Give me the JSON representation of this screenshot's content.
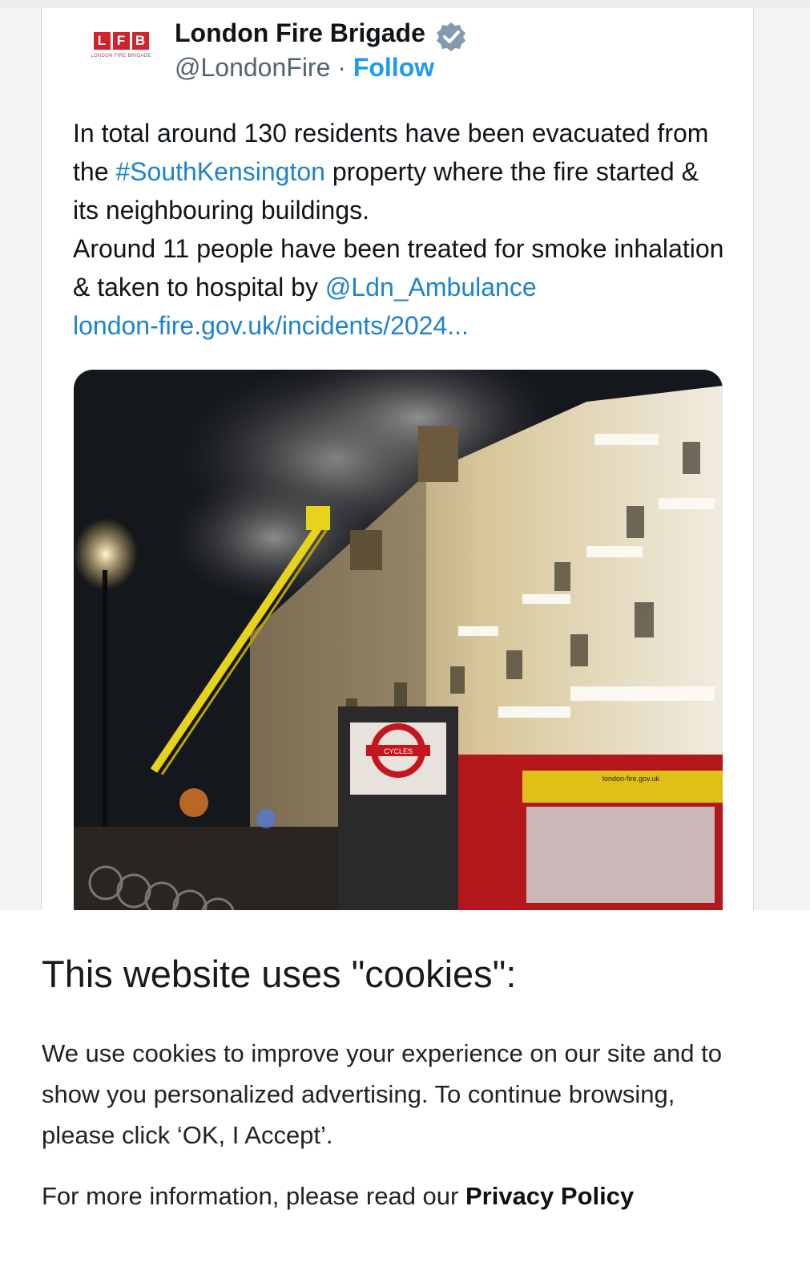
{
  "tweet": {
    "author_name": "London Fire Brigade",
    "handle": "@LondonFire",
    "separator": "·",
    "follow_label": "Follow",
    "logo": {
      "letters": [
        "L",
        "F",
        "B"
      ],
      "subtitle": "LONDON FIRE BRIGADE"
    },
    "text": {
      "line1_pre": "In total around 130 residents have been evacuated from the ",
      "hashtag": "#SouthKensington",
      "line1_post": " property where the fire started & its neighbouring buildings.",
      "line2_pre": "Around 11 people have been treated for smoke inhalation & taken to hospital by ",
      "mention": "@Ldn_Ambulance",
      "link": "london-fire.gov.uk/incidents/2024..."
    },
    "photo": {
      "signage_text": "CYCLES",
      "vehicle_text": "london-fire.gov.uk"
    }
  },
  "cookie_banner": {
    "title": "This website uses \"cookies\":",
    "body": "We use cookies to improve your experience on our site and to show you personalized advertising. To continue browsing, please click ‘OK, I Accept’.",
    "more_info_prefix": "For more information, please read our ",
    "privacy_link": "Privacy Policy"
  },
  "colors": {
    "link": "#1d83cb",
    "follow": "#1d9bf0",
    "brand_red": "#d2232a",
    "verified_badge": "#829aab"
  },
  "icons": {
    "verified": "verified-badge-icon"
  }
}
